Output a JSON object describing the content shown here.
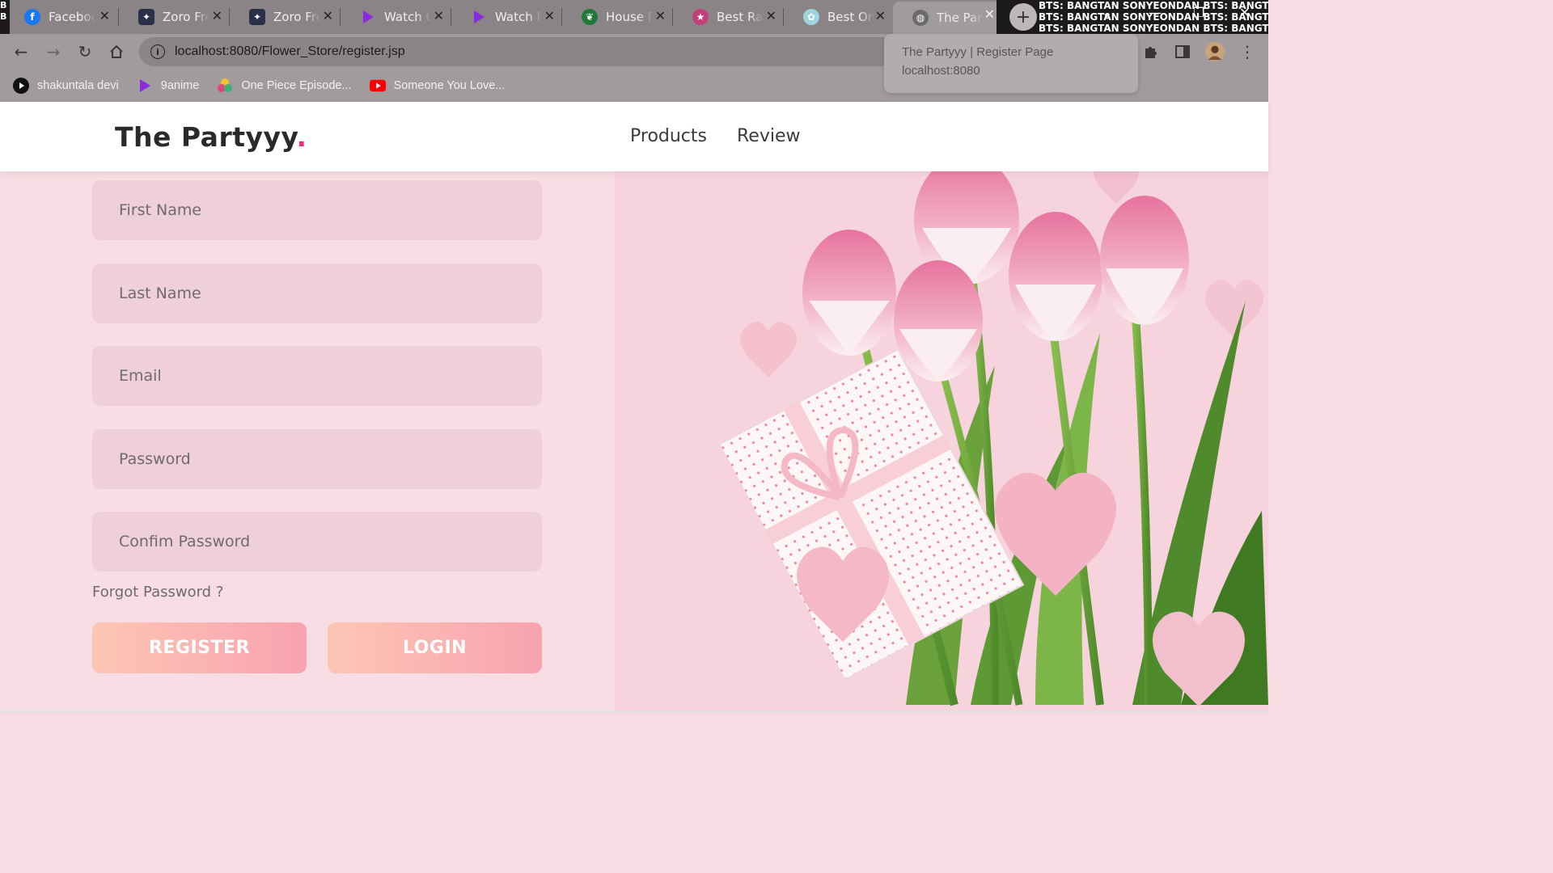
{
  "browser": {
    "tabs": [
      {
        "title": "Facebook",
        "icon": "facebook-icon",
        "color": "#1877f2"
      },
      {
        "title": "Zoro Free",
        "icon": "zoro-icon",
        "color": "#2a2f4a"
      },
      {
        "title": "Zoro Free",
        "icon": "zoro-icon",
        "color": "#2a2f4a"
      },
      {
        "title": "Watch O",
        "icon": "play-icon",
        "color": "#8a2be2"
      },
      {
        "title": "Watch M",
        "icon": "play-icon",
        "color": "#8a2be2"
      },
      {
        "title": "House Pl",
        "icon": "plant-icon",
        "color": "#1f7a3a"
      },
      {
        "title": "Best Rate",
        "icon": "badge-icon",
        "color": "#c2407a"
      },
      {
        "title": "Best Onl",
        "icon": "flower-icon",
        "color": "#9fd3e0"
      },
      {
        "title": "The Party",
        "icon": "globe-icon",
        "color": "#6b6b6b"
      }
    ],
    "new_tab_label": "+",
    "banner_text": "BTS: BANGTAN SONYEONDAN BTS: BANGTAN SONYEONDAN",
    "url": "localhost:8080/Flower_Store/register.jsp",
    "tooltip": {
      "title": "The Partyyy | Register Page",
      "host": "localhost:8080"
    },
    "extension_badge": "off",
    "bookmarks": [
      {
        "label": "shakuntala devi",
        "icon": "play-circle-icon"
      },
      {
        "label": "9anime",
        "icon": "play-icon"
      },
      {
        "label": "One Piece Episode...",
        "icon": "flower-icon"
      },
      {
        "label": "Someone You Love...",
        "icon": "youtube-icon"
      }
    ]
  },
  "site": {
    "logo_text": "The Partyyy",
    "logo_dot": ".",
    "nav": [
      {
        "label": "Products"
      },
      {
        "label": "Review"
      }
    ]
  },
  "form": {
    "first_name_placeholder": "First Name",
    "last_name_placeholder": "Last Name",
    "email_placeholder": "Email",
    "password_placeholder": "Password",
    "confirm_password_placeholder": "Confim Password",
    "forgot_password": "Forgot Password ?",
    "register_label": "REGISTER",
    "login_label": "LOGIN"
  },
  "colors": {
    "page_bg": "#f9dde4",
    "field_bg": "#efd0d8",
    "accent_dot": "#e8347c",
    "button_gradient_start": "#fdc6b4",
    "button_gradient_end": "#f8a2b0"
  }
}
